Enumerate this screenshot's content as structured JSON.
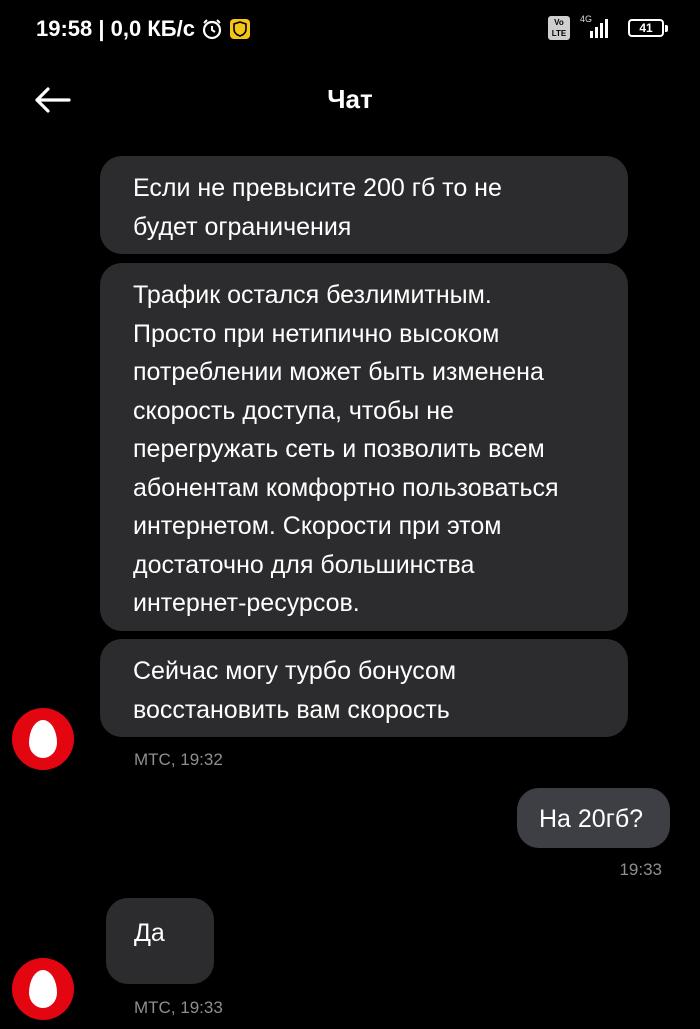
{
  "status_bar": {
    "time_speed": "19:58 | 0,0 КБ/с",
    "volte": "Vo\nLTE",
    "network": "4G",
    "battery": "41",
    "icons": [
      "alarm-icon",
      "shield-icon",
      "volte-icon",
      "signal-icon",
      "battery-icon"
    ]
  },
  "header": {
    "title": "Чат",
    "back_icon": "arrow-left-icon"
  },
  "messages": [
    {
      "direction": "in",
      "text": "Если не превысите 200 гб то не\nбудет ограничения"
    },
    {
      "direction": "in",
      "text": "Трафик остался безлимитным.\nПросто при нетипично высоком\nпотреблении может быть изменена\nскорость доступа, чтобы не\nперегружать сеть и позволить всем\nабонентам комфортно пользоваться\nинтернетом. Скорости при этом\nдостаточно для большинства\nинтернет-ресурсов."
    },
    {
      "direction": "in",
      "text": "Сейчас могу турбо бонусом\nвосстановить вам скорость",
      "meta": "МТС, 19:32"
    },
    {
      "direction": "out",
      "text": "На 20гб?",
      "meta": "19:33"
    },
    {
      "direction": "in",
      "text": "Да",
      "meta": "МТС, 19:33"
    }
  ],
  "colors": {
    "background": "#000000",
    "bubble_in": "#2c2c2e",
    "bubble_out": "#3d3f44",
    "meta_text": "#8e8e93",
    "avatar_brand": "#e30611",
    "shield_accent": "#f5c518"
  }
}
